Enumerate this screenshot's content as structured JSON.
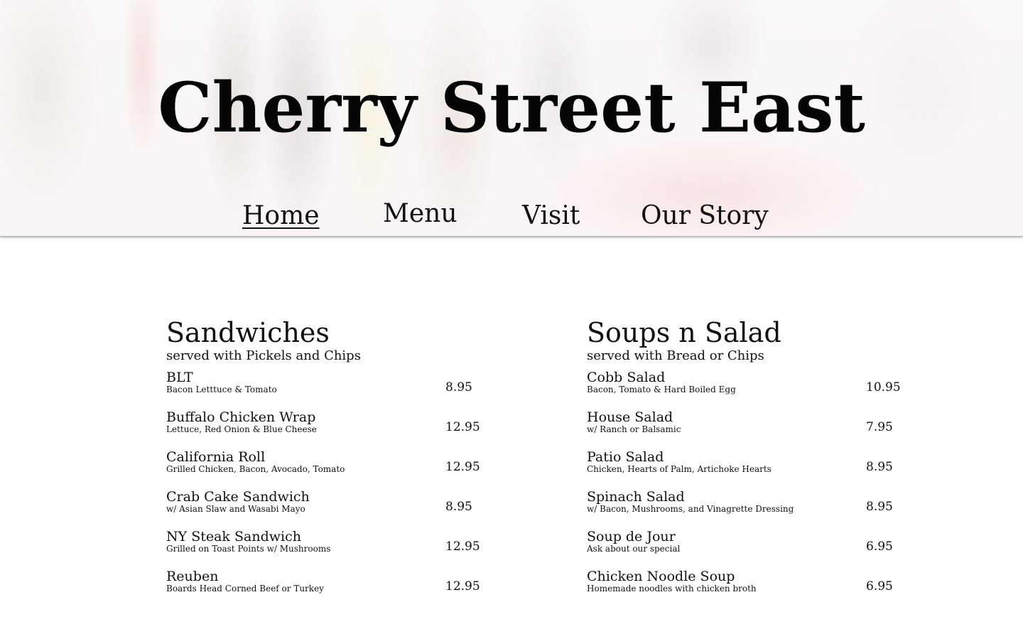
{
  "site": {
    "title": "Cherry Street East"
  },
  "nav": {
    "items": [
      {
        "label": "Home",
        "active": true
      },
      {
        "label": "Menu",
        "active": false
      },
      {
        "label": "Visit",
        "active": false
      },
      {
        "label": "Our Story",
        "active": false
      }
    ]
  },
  "sections": [
    {
      "title": "Sandwiches",
      "subtitle": "served with Pickels and Chips",
      "items": [
        {
          "name": "BLT",
          "description": "Bacon Letttuce & Tomato",
          "price": "8.95"
        },
        {
          "name": "Buffalo Chicken Wrap",
          "description": "Lettuce, Red Onion & Blue Cheese",
          "price": "12.95"
        },
        {
          "name": "California Roll",
          "description": "Grilled Chicken, Bacon, Avocado, Tomato",
          "price": "12.95"
        },
        {
          "name": "Crab Cake Sandwich",
          "description": "w/ Asian Slaw and Wasabi Mayo",
          "price": "8.95"
        },
        {
          "name": "NY Steak Sandwich",
          "description": "Grilled on Toast Points w/ Mushrooms",
          "price": "12.95"
        },
        {
          "name": "Reuben",
          "description": "Boards Head Corned Beef or Turkey",
          "price": "12.95"
        }
      ]
    },
    {
      "title": "Soups n Salad",
      "subtitle": "served with Bread or Chips",
      "items": [
        {
          "name": "Cobb Salad",
          "description": "Bacon, Tomato & Hard Boiled Egg",
          "price": "10.95"
        },
        {
          "name": "House Salad",
          "description": "w/ Ranch or Balsamic",
          "price": "7.95"
        },
        {
          "name": "Patio Salad",
          "description": "Chicken, Hearts of Palm, Artichoke Hearts",
          "price": "8.95"
        },
        {
          "name": "Spinach Salad",
          "description": "w/ Bacon, Mushrooms, and Vinagrette Dressing",
          "price": "8.95"
        },
        {
          "name": "Soup de Jour",
          "description": "Ask about our special",
          "price": "6.95"
        },
        {
          "name": "Chicken Noodle Soup",
          "description": "Homemade noodles with chicken broth",
          "price": "6.95"
        }
      ]
    }
  ]
}
